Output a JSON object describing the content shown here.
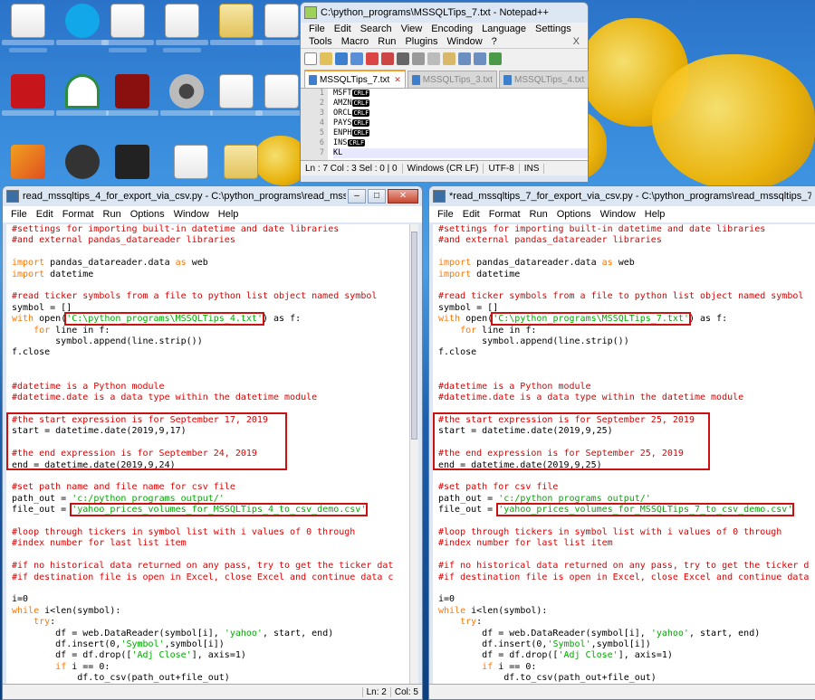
{
  "desktop": {
    "icons": [
      "pdf-icon",
      "skype-icon",
      "document-icon",
      "document-icon",
      "folder-icon",
      "app-icon",
      "acrobat-icon",
      "network-icon",
      "app-icon",
      "webcam-icon",
      "document-icon",
      "app-icon",
      "music-icon",
      "disc-icon",
      "media-icon",
      "document-icon",
      "folder-icon",
      "document-icon"
    ]
  },
  "npp": {
    "title": "C:\\python_programs\\MSSQLTips_7.txt - Notepad++",
    "menu": [
      "File",
      "Edit",
      "Search",
      "View",
      "Encoding",
      "Language",
      "Settings",
      "Tools",
      "Macro",
      "Run",
      "Plugins",
      "Window",
      "?"
    ],
    "menu_close": "X",
    "tabs": [
      "MSSQLTips_7.txt",
      "MSSQLTips_3.txt",
      "MSSQLTips_4.txt"
    ],
    "line_numbers": [
      "1",
      "2",
      "3",
      "4",
      "5",
      "6",
      "7"
    ],
    "lines": [
      "MSFT",
      "AMZN",
      "ORCL",
      "PAYS",
      "ENPH",
      "INS",
      "KL"
    ],
    "eol_label": "CRLF",
    "status": {
      "pos": "Ln : 7    Col : 3    Sel : 0 | 0",
      "eol": "Windows (CR LF)",
      "enc": "UTF-8",
      "mode": "INS"
    }
  },
  "left": {
    "title": "read_mssqltips_4_for_export_via_csv.py - C:\\python_programs\\read_mssqltips_4_for_e...",
    "menu": [
      "File",
      "Edit",
      "Format",
      "Run",
      "Options",
      "Window",
      "Help"
    ],
    "status": {
      "ln": "Ln: 2",
      "col": "Col: 5"
    },
    "file_in": "C:\\python_programs\\MSSQLTips_4.txt",
    "start_comment": "#the start expression is for September 17, 2019",
    "start_date": "start = datetime.date(2019,9,17)",
    "end_comment": "#the end expression is for September 24, 2019",
    "end_date": "end = datetime.date(2019,9,24)",
    "path_comment": "#set path name and file name for csv file",
    "file_out": "yahoo_prices_volumes_for_MSSQLTips_4_to_csv_demo.csv",
    "trunc1": "#if no historical data returned on any pass, try to get the ticker dat",
    "trunc2": "#if destination file is open in Excel, close Excel and continue data c",
    "trunc3": "#read ticker symbols from a file to python list object named symbol"
  },
  "right": {
    "title": "*read_mssqltips_7_for_export_via_csv.py - C:\\python_programs\\read_mssqltips_7_for_export_via_cs",
    "menu": [
      "File",
      "Edit",
      "Format",
      "Run",
      "Options",
      "Window",
      "Help"
    ],
    "file_in": "C:\\python_programs\\MSSQLTips_7.txt",
    "start_comment": "#the start expression is for September 25, 2019",
    "start_date": "start = datetime.date(2019,9,25)",
    "end_comment": "#the end expression is for September 25, 2019",
    "end_date": "end = datetime.date(2019,9,25)",
    "path_comment": "#set path for csv file",
    "file_out": "yahoo_prices_volumes_for_MSSQLTips_7_to_csv_demo.csv",
    "trunc1": "#if no historical data returned on any pass, try to get the ticker d",
    "trunc2": "#if destination file is open in Excel, close Excel and continue data",
    "trunc3": "#read ticker symbols from a file to python list object named symbol"
  },
  "code": {
    "c1": "#settings for importing built-in datetime and date libraries",
    "c2": "#and external pandas_datareader libraries",
    "import_kw": "import",
    "import1": " pandas_datareader.data ",
    "as_kw": "as",
    "import1b": " web",
    "import2": " datetime",
    "sym": "symbol = []",
    "with_kw": "with",
    "open_fn": " open(",
    "q1": "'",
    "q2": "'",
    "as_f": ") as f:",
    "for_kw": "for",
    "for_rest": " line in f:",
    "for_ind": "    ",
    "append": "        symbol.append(line.strip())",
    "close": "f.close",
    "dt1": "#datetime is a Python module",
    "dt2": "#datetime.date is a data type within the datetime module",
    "path_out": "path_out = ",
    "path_str": "'c:/python_programs_output/'",
    "file_out_lbl": "file_out = ",
    "loop1": "#loop through tickers in symbol list with i values of 0 through",
    "loop2": "#index number for last list item",
    "i0": "i=0",
    "while_kw": "while",
    "while_rest": " i<len(symbol):",
    "try_ind": "    ",
    "try_kw": "try",
    "try_colon": ":",
    "df1a": "        df = web.DataReader(symbol[i], ",
    "yahoo": "'yahoo'",
    "df1b": ", start, end)",
    "df2a": "        df.insert(0,",
    "symstr": "'Symbol'",
    "df2b": ",symbol[i])",
    "df3a": "        df = df.drop([",
    "adj": "'Adj Close'",
    "df3b": "], axis=1)",
    "if_ind": "        ",
    "if_kw": "if",
    "if_rest": " i == 0:",
    "tocsv": "            df.to_csv(path_out+file_out)"
  }
}
